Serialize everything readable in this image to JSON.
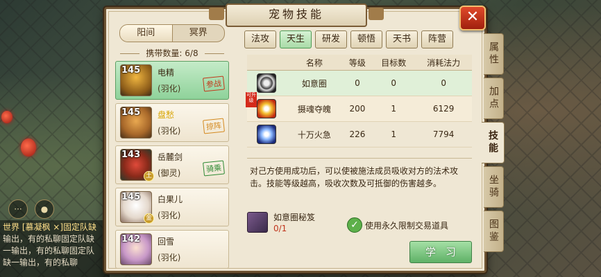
{
  "window": {
    "title": "宠物技能",
    "close_label": "✕"
  },
  "world_toggle": {
    "options": [
      "阳间",
      "冥界"
    ],
    "selected": "阳间"
  },
  "carry": {
    "label": "携带数量:",
    "value": "6/8"
  },
  "pets": [
    {
      "level": "145",
      "name": "电精",
      "type": "(羽化)",
      "stamp": "参战",
      "stamp_color": "#c23a1c",
      "selected": true,
      "portrait": "dragon-warrior"
    },
    {
      "level": "145",
      "name": "盘愁",
      "type": "(羽化)",
      "stamp": "掠阵",
      "stamp_color": "#d48a20",
      "selected": false,
      "portrait": "lion-cat"
    },
    {
      "level": "143",
      "name": "岳麓剑",
      "type": "(御灵)",
      "stamp": "骑乘",
      "stamp_color": "#2e8a34",
      "selected": false,
      "portrait": "red-flower",
      "badge": "土"
    },
    {
      "level": "145",
      "name": "白果儿",
      "type": "(羽化)",
      "stamp": "",
      "selected": false,
      "portrait": "white-cat",
      "badge": "金"
    },
    {
      "level": "142",
      "name": "回雪",
      "type": "(羽化)",
      "stamp": "",
      "selected": false,
      "portrait": "girl"
    }
  ],
  "skill_tabs": [
    "法攻",
    "天生",
    "研发",
    "顿悟",
    "天书",
    "阵营"
  ],
  "skill_tab_selected": "天生",
  "table": {
    "headers": [
      "",
      "名称",
      "等级",
      "目标数",
      "消耗法力"
    ],
    "rows": [
      {
        "icon": "ring-skill-icon",
        "name": "如意圈",
        "level": "0",
        "targets": "0",
        "mana": "0"
      },
      {
        "icon": "soul-seize-skill-icon",
        "name": "摄魂夺魄",
        "level": "200",
        "targets": "1",
        "mana": "6129"
      },
      {
        "icon": "fire-rush-skill-icon",
        "name": "十万火急",
        "level": "226",
        "targets": "1",
        "mana": "7794"
      }
    ]
  },
  "new_flag": "可升级",
  "description": "对己方使用成功后，可以使被施法成员吸收对方的法术攻击。技能等级越高，吸收次数及可抵御的伤害越多。",
  "book": {
    "name": "如意圈秘笈",
    "count": "0/1"
  },
  "option": {
    "label": "使用永久限制交易道具",
    "checked": true
  },
  "learn_button": "学习",
  "side_tabs": [
    "属性",
    "加点",
    "技能",
    "坐骑",
    "图鉴"
  ],
  "side_tab_selected": "技能",
  "chat": {
    "lines": [
      "世界 [慕凝枫 ×]固定队缺",
      "输出，有的私聊固定队缺",
      "一输出，有的私聊固定队",
      "缺一输出，有的私聊"
    ]
  },
  "colors": {
    "accent_green": "#8fd29a",
    "frame_brown": "#6e5433",
    "parchment": "#efe7d4",
    "close_red": "#c0341c"
  }
}
